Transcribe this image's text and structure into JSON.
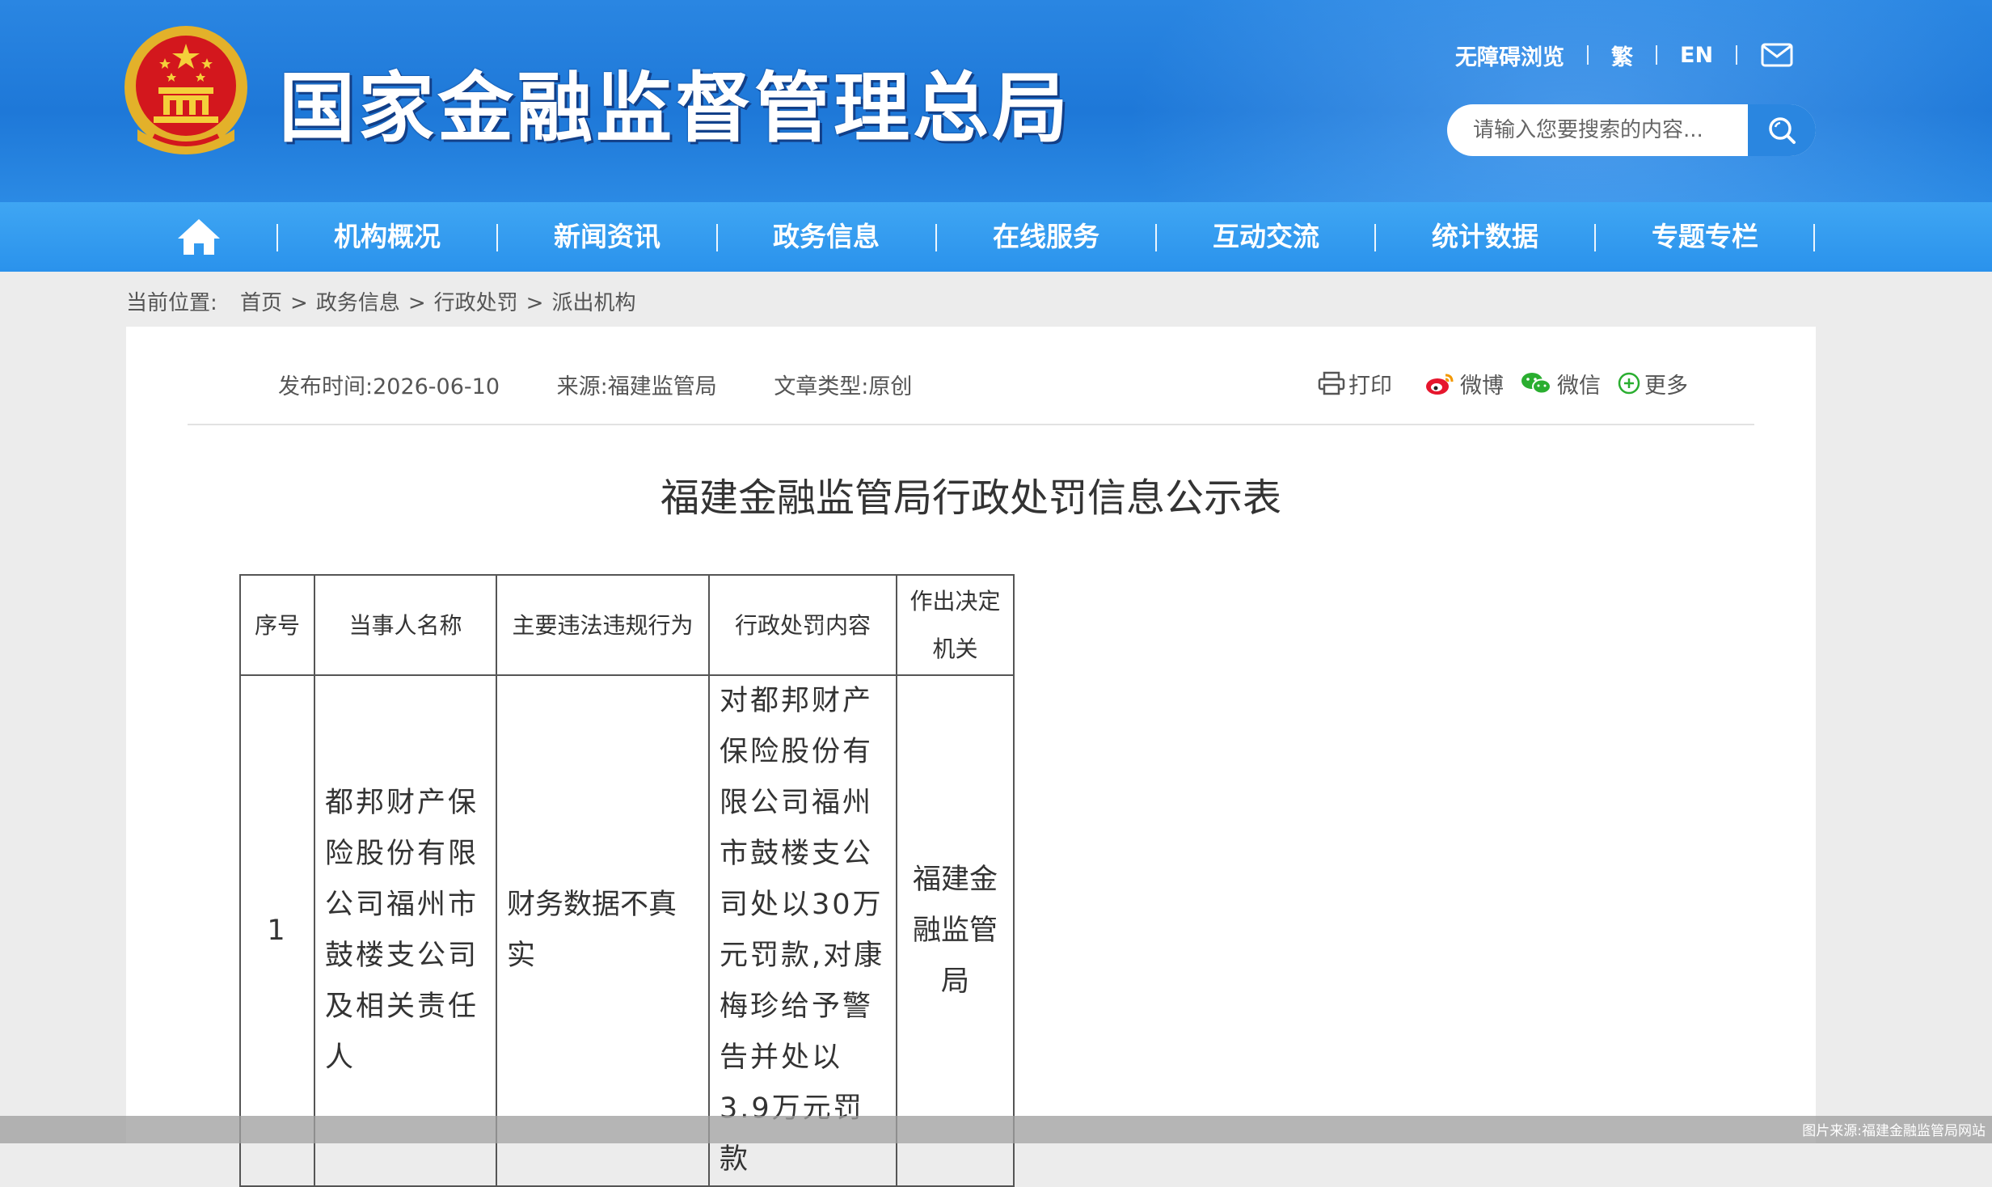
{
  "header": {
    "site_title": "国家金融监督管理总局",
    "accessibility": "无障碍浏览",
    "traditional": "繁",
    "english": "EN",
    "mail_icon": "mail-icon",
    "search_placeholder": "请输入您要搜索的内容...",
    "search_icon": "search-icon"
  },
  "nav": {
    "home_icon": "home-icon",
    "items": [
      "机构概况",
      "新闻资讯",
      "政务信息",
      "在线服务",
      "互动交流",
      "统计数据",
      "专题专栏"
    ]
  },
  "breadcrumb": {
    "label": "当前位置:",
    "items": [
      "首页",
      "政务信息",
      "行政处罚",
      "派出机构"
    ],
    "separator": ">"
  },
  "meta": {
    "publish_time": "发布时间:2026-06-10",
    "source": "来源:福建监管局",
    "article_type": "文章类型:原创"
  },
  "share": {
    "print": "打印",
    "weibo": "微博",
    "wechat": "微信",
    "more": "更多"
  },
  "document": {
    "title": "福建金融监管局行政处罚信息公示表"
  },
  "table": {
    "headers": [
      "序号",
      "当事人名称",
      "主要违法违规行为",
      "行政处罚内容",
      "作出决定机关"
    ],
    "rows": [
      {
        "index": "1",
        "party": "都邦财产保险股份有限公司福州市鼓楼支公司及相关责任人",
        "violation": "财务数据不真实",
        "penalty": "对都邦财产保险股份有限公司福州市鼓楼支公司处以30万元罚款,对康梅珍给予警告并处以3.9万元罚款",
        "authority": "福建金融监管局"
      }
    ]
  },
  "footer": {
    "credit": "图片来源:福建金融监管局网站"
  },
  "colors": {
    "header_blue": "#1e78d8",
    "nav_blue": "#3fa6f3",
    "search_button": "#2a86e0"
  }
}
